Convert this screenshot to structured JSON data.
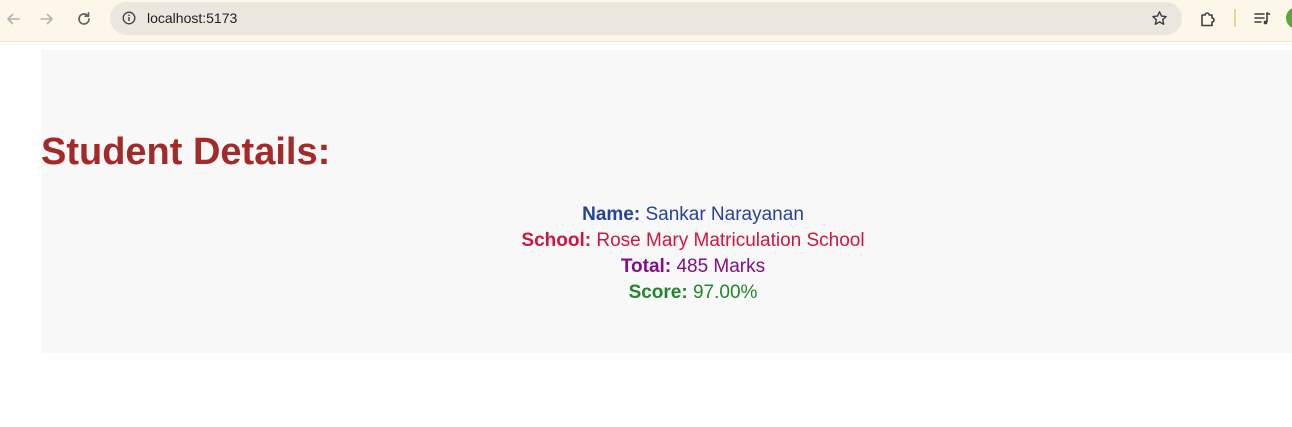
{
  "browser": {
    "url": "localhost:5173",
    "icons": [
      "back-arrow",
      "forward-arrow",
      "reload",
      "site-info",
      "bookmark-star",
      "extensions-puzzle",
      "media-control",
      "profile"
    ]
  },
  "student": {
    "heading": "Student Details:",
    "name_label": "Name:",
    "name_value": "Sankar Narayanan",
    "school_label": "School:",
    "school_value": "Rose Mary Matriculation School",
    "total_label": "Total:",
    "total_value": "485 Marks",
    "score_label": "Score:",
    "score_value": "97.00%"
  },
  "colors": {
    "heading": "#a42a2a",
    "name": "#24439c",
    "school": "#d0163f",
    "total": "#7f1085",
    "score": "#22862a",
    "card_bg": "#f8f8f8"
  }
}
